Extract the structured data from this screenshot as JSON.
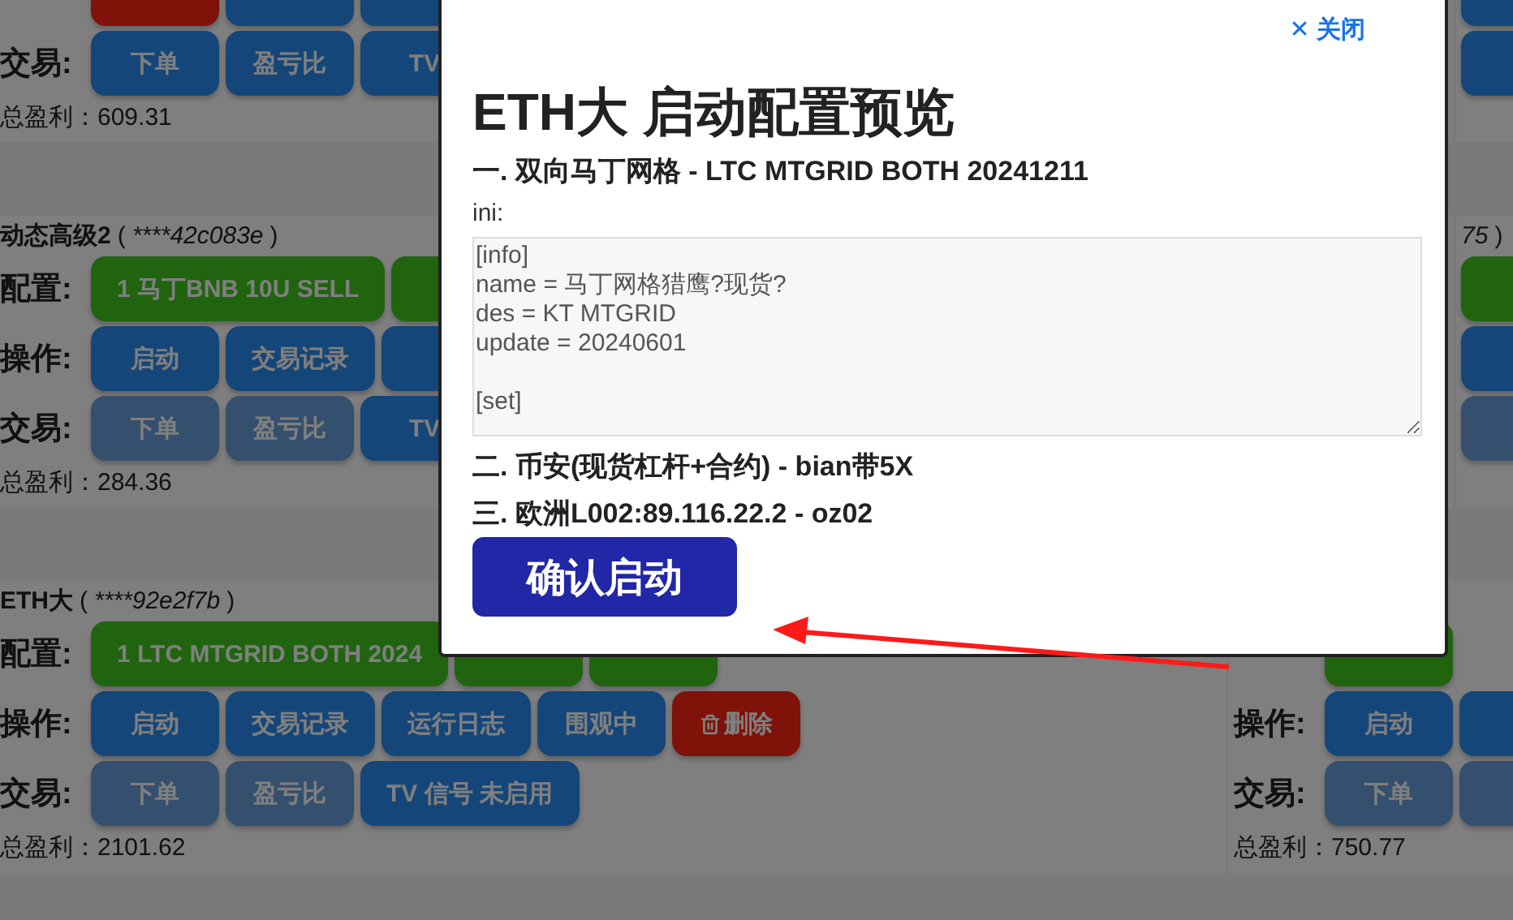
{
  "board": {
    "rows": [
      {
        "cards": [
          {
            "rows": [
              {
                "buttons": [
                  {
                    "kind": "red"
                  },
                  {
                    "kind": "blue"
                  },
                  {
                    "kind": "blue"
                  }
                ]
              },
              {
                "label": "交易:",
                "buttons": [
                  {
                    "label": "下单",
                    "kind": "blue"
                  },
                  {
                    "label": "盈亏比",
                    "kind": "blue"
                  },
                  {
                    "label": "TV",
                    "kind": "blue"
                  }
                ]
              }
            ],
            "total": "总盈利：609.31"
          },
          {
            "rows": [
              {
                "buttons": [
                  {
                    "kind": "blue"
                  }
                ]
              },
              {
                "buttons": [
                  {
                    "kind": "blue"
                  }
                ]
              }
            ]
          }
        ]
      },
      {
        "cards": [
          {
            "title": {
              "name": "动态高级2",
              "open": "(",
              "key": "****42c083e",
              "close": ")"
            },
            "rows": [
              {
                "label": "配置:",
                "buttons": [
                  {
                    "label": "1 马丁BNB 10U SELL",
                    "kind": "green"
                  },
                  {
                    "kind": "green"
                  }
                ]
              },
              {
                "label": "操作:",
                "buttons": [
                  {
                    "label": "启动",
                    "kind": "blue"
                  },
                  {
                    "label": "交易记录",
                    "kind": "blue"
                  },
                  {
                    "kind": "blue"
                  }
                ]
              },
              {
                "label": "交易:",
                "buttons": [
                  {
                    "label": "下单",
                    "kind": "faded"
                  },
                  {
                    "label": "盈亏比",
                    "kind": "faded"
                  },
                  {
                    "label": "TV",
                    "kind": "blue"
                  }
                ]
              }
            ],
            "total": "总盈利：284.36"
          },
          {
            "title": {
              "key": "75",
              "close": ")"
            },
            "rows": [
              {
                "buttons": [
                  {
                    "kind": "green"
                  }
                ]
              },
              {
                "buttons": [
                  {
                    "kind": "blue"
                  }
                ]
              },
              {
                "buttons": [
                  {
                    "kind": "faded"
                  }
                ]
              }
            ]
          }
        ]
      },
      {
        "cards": [
          {
            "title": {
              "name": "ETH大",
              "open": "(",
              "key": "****92e2f7b",
              "close": ")"
            },
            "rows": [
              {
                "label": "配置:",
                "buttons": [
                  {
                    "label": "1 LTC MTGRID BOTH 2024",
                    "kind": "green"
                  },
                  {
                    "kind": "green"
                  },
                  {
                    "kind": "green"
                  }
                ]
              },
              {
                "label": "操作:",
                "buttons": [
                  {
                    "label": "启动",
                    "kind": "blue"
                  },
                  {
                    "label": "交易记录",
                    "kind": "blue"
                  },
                  {
                    "label": "运行日志",
                    "kind": "blue"
                  },
                  {
                    "label": "围观中",
                    "kind": "blue"
                  },
                  {
                    "label": "删除",
                    "kind": "delete"
                  }
                ]
              },
              {
                "label": "交易:",
                "buttons": [
                  {
                    "label": "下单",
                    "kind": "faded"
                  },
                  {
                    "label": "盈亏比",
                    "kind": "faded"
                  },
                  {
                    "label": "TV 信号 未启用",
                    "kind": "blue"
                  }
                ]
              }
            ],
            "total": "总盈利：2101.62"
          },
          {
            "rows": [
              {
                "buttons": [
                  {
                    "kind": "green"
                  }
                ]
              },
              {
                "label": "操作:",
                "buttons": [
                  {
                    "label": "启动",
                    "kind": "blue"
                  },
                  {
                    "kind": "blue"
                  }
                ]
              },
              {
                "label": "交易:",
                "buttons": [
                  {
                    "label": "下单",
                    "kind": "faded"
                  },
                  {
                    "kind": "faded"
                  }
                ]
              }
            ],
            "total": "总盈利：750.77"
          }
        ]
      }
    ]
  },
  "dialog": {
    "close": "✕ 关闭",
    "title": "ETH大 启动配置预览",
    "sections": [
      {
        "heading": "一. 双向马丁网格 - LTC MTGRID BOTH 20241211",
        "ini_label": "ini:",
        "ini_blocks": [
          [
            "[info]",
            "name = 马丁网格猎鹰?现货?",
            "des = KT MTGRID",
            "update = 20240601"
          ],
          [
            "[set]"
          ]
        ]
      },
      {
        "heading": "二. 币安(现货杠杆+合约) - bian带5X"
      },
      {
        "heading": "三. 欧洲L002:89.116.22.2 - oz02"
      }
    ],
    "confirm": "确认启动"
  }
}
